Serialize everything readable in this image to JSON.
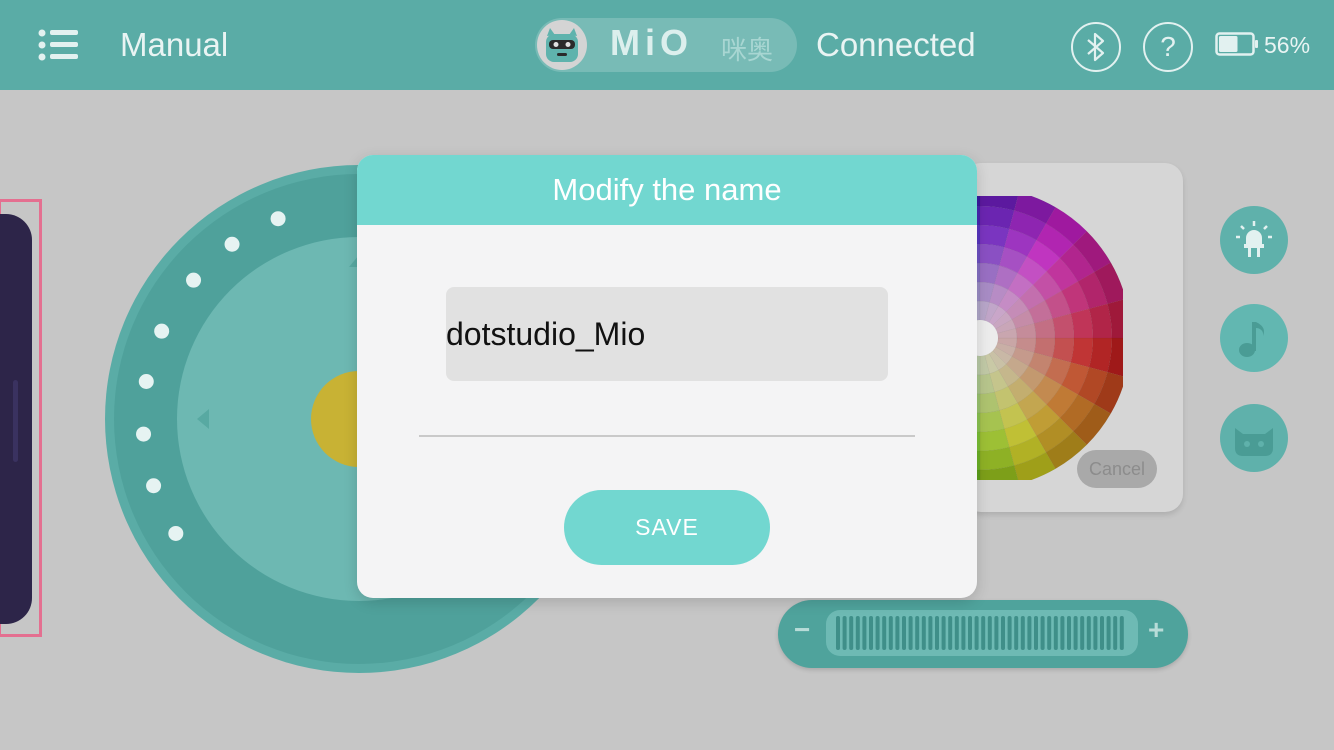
{
  "header": {
    "title": "Manual",
    "brand_name": "MiO",
    "brand_name_cn": "咪奥",
    "status": "Connected",
    "help_label": "?",
    "battery_percent": "56%",
    "battery_level": 0.56,
    "icons": [
      "menu-icon",
      "robot-avatar",
      "bluetooth-icon",
      "help-icon",
      "battery-icon"
    ]
  },
  "color_panel": {
    "cancel_label": "Cancel"
  },
  "side_buttons": [
    "led-icon",
    "music-note-icon",
    "cat-face-icon"
  ],
  "speed_slider": {
    "minus_label": "−",
    "plus_label": "+"
  },
  "dialog": {
    "title": "Modify the name",
    "name_value": "dotstudio_Mio",
    "save_label": "SAVE"
  },
  "colors": {
    "header_bg": "#5aaca6",
    "accent": "#72d7d0",
    "overlay_bg": "#c6c6c6",
    "joystick_outer": "#5aaca6",
    "joystick_inner": "#6db8b2",
    "joystick_center": "#c8b234",
    "left_panel": "#2d2549",
    "highlight_outline": "#e46f90"
  }
}
